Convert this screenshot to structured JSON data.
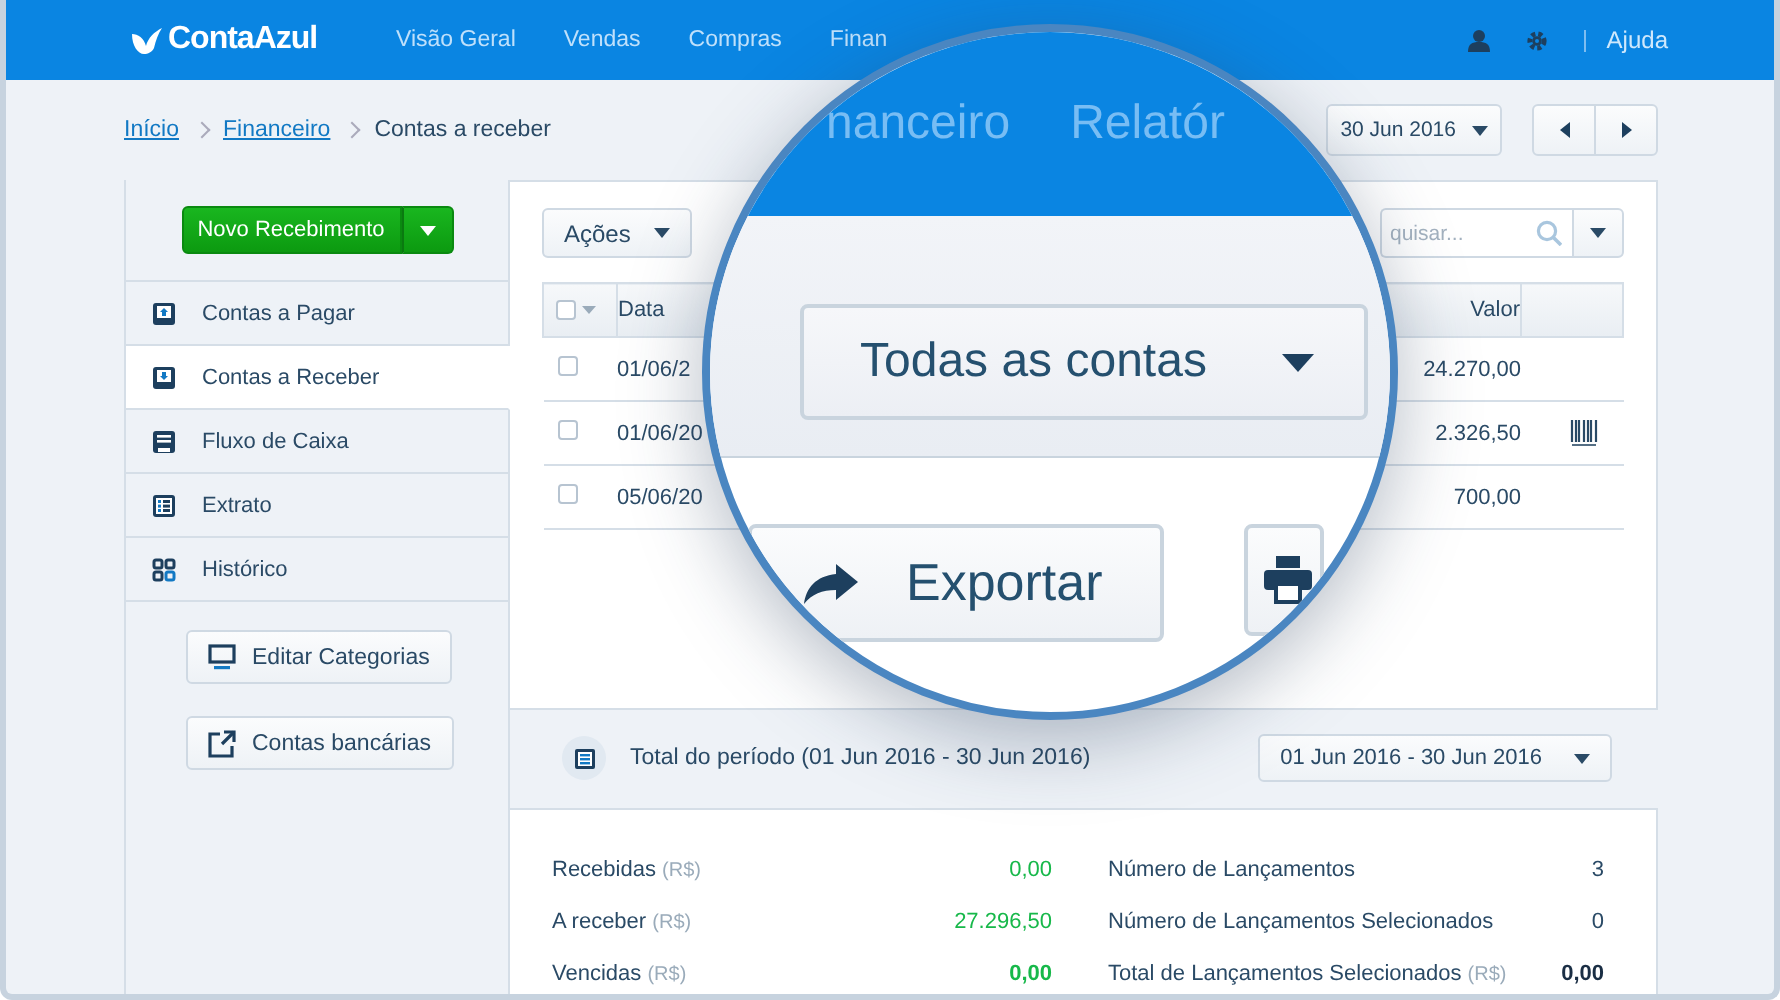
{
  "header": {
    "logo": "ContaAzul",
    "nav": [
      {
        "label": "Visão Geral"
      },
      {
        "label": "Vendas"
      },
      {
        "label": "Compras"
      },
      {
        "label": "Finan"
      }
    ],
    "help": "Ajuda"
  },
  "breadcrumb": [
    {
      "label": "Início",
      "link": true
    },
    {
      "label": "Financeiro",
      "link": true
    },
    {
      "label": "Contas a receber",
      "link": false
    }
  ],
  "period_picker": {
    "value": "30 Jun 2016"
  },
  "sidebar": {
    "new_button": "Novo Recebimento",
    "items": [
      {
        "label": "Contas a Pagar",
        "selected": false
      },
      {
        "label": "Contas a Receber",
        "selected": true
      },
      {
        "label": "Fluxo de Caixa",
        "selected": false
      },
      {
        "label": "Extrato",
        "selected": false
      },
      {
        "label": "Histórico",
        "selected": false
      }
    ],
    "buttons": [
      "Editar Categorias",
      "Contas bancárias"
    ]
  },
  "toolbar": {
    "actions": "Ações",
    "search": {
      "placeholder": "quisar..."
    }
  },
  "table": {
    "select_all_checked": false,
    "columns": [
      "Data",
      "Valor"
    ],
    "rows": [
      {
        "date": "01/06/2",
        "value": "24.270,00",
        "checked": false,
        "barcode": false
      },
      {
        "date": "01/06/20",
        "value": "2.326,50",
        "checked": false,
        "barcode": true
      },
      {
        "date": "05/06/20",
        "value": "700,00",
        "checked": false,
        "barcode": false
      }
    ]
  },
  "summary": {
    "title": "Total do período (01 Jun 2016 - 30 Jun 2016)",
    "range": "01 Jun 2016 - 30 Jun 2016",
    "left": [
      {
        "label": "Recebidas",
        "unit": "(R$)",
        "value": "0,00",
        "color": "#17b84a",
        "bold": false
      },
      {
        "label": "A receber",
        "unit": "(R$)",
        "value": "27.296,50",
        "color": "#17b84a",
        "bold": false
      },
      {
        "label": "Vencidas",
        "unit": "(R$)",
        "value": "0,00",
        "color": "#17b84a",
        "bold": true
      }
    ],
    "right": [
      {
        "label": "Número de Lançamentos",
        "value": "3",
        "color": "#2a4a66",
        "bold": false
      },
      {
        "label": "Número de Lançamentos Selecionados",
        "value": "0",
        "color": "#2a4a66",
        "bold": false
      },
      {
        "label": "Total de Lançamentos Selecionados",
        "unit": "(R$)",
        "value": "0,00",
        "color": "#1a2e44",
        "bold": true
      }
    ]
  },
  "magnifier": {
    "tabs": [
      "nanceiro",
      "Relatór"
    ],
    "filter": "Todas as contas",
    "buttons": [
      {
        "kind": "export",
        "label": "Exportar"
      },
      {
        "kind": "print"
      }
    ]
  }
}
